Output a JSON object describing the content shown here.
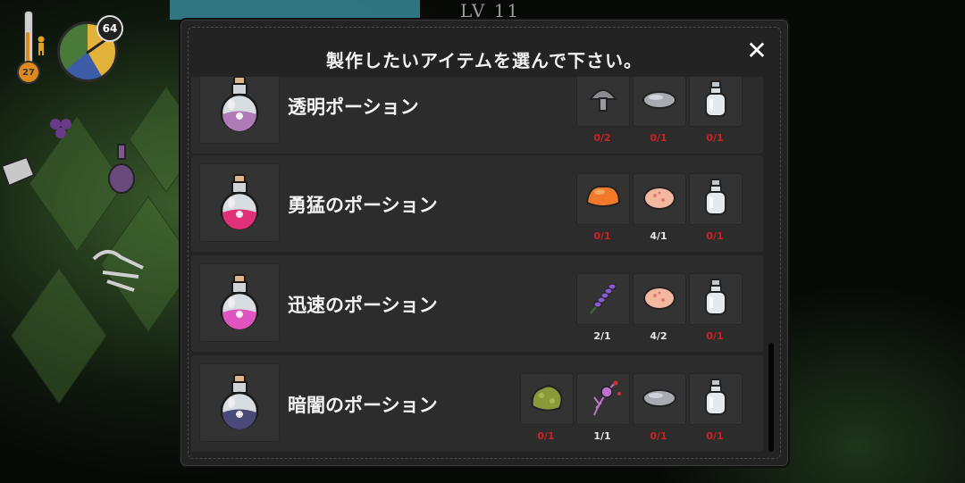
{
  "hud": {
    "temperature": "27",
    "day_counter": "64"
  },
  "background": {
    "level_text": "LV 11"
  },
  "modal": {
    "title": "製作したいアイテムを選んで下さい。",
    "close_label": "✕"
  },
  "recipes": [
    {
      "name": "透明ポーション",
      "potion_color": "#b07ab8",
      "ingredients": [
        {
          "icon": "mushroom-icon",
          "qty": "0/2",
          "enough": false
        },
        {
          "icon": "stone-icon",
          "qty": "0/1",
          "enough": false
        },
        {
          "icon": "empty-bottle-icon",
          "qty": "0/1",
          "enough": false
        }
      ]
    },
    {
      "name": "勇猛のポーション",
      "potion_color": "#e0307a",
      "ingredients": [
        {
          "icon": "orange-mushroom-icon",
          "qty": "0/1",
          "enough": false
        },
        {
          "icon": "pink-stone-icon",
          "qty": "4/1",
          "enough": true
        },
        {
          "icon": "empty-bottle-icon",
          "qty": "0/1",
          "enough": false
        }
      ]
    },
    {
      "name": "迅速のポーション",
      "potion_color": "#e054c0",
      "ingredients": [
        {
          "icon": "lavender-icon",
          "qty": "2/1",
          "enough": true
        },
        {
          "icon": "pink-stone-icon",
          "qty": "4/2",
          "enough": true
        },
        {
          "icon": "empty-bottle-icon",
          "qty": "0/1",
          "enough": false
        }
      ]
    },
    {
      "name": "暗闇のポーション",
      "potion_color": "#4a4a78",
      "ingredients": [
        {
          "icon": "moss-icon",
          "qty": "0/1",
          "enough": false
        },
        {
          "icon": "purple-flower-icon",
          "qty": "1/1",
          "enough": true
        },
        {
          "icon": "stone-icon",
          "qty": "0/1",
          "enough": false
        },
        {
          "icon": "empty-bottle-icon",
          "qty": "0/1",
          "enough": false
        }
      ]
    }
  ],
  "colors": {
    "shortage": "#cc2222",
    "sufficient": "#e8e8e8",
    "panel": "#232323",
    "row": "#2c2c2c"
  }
}
